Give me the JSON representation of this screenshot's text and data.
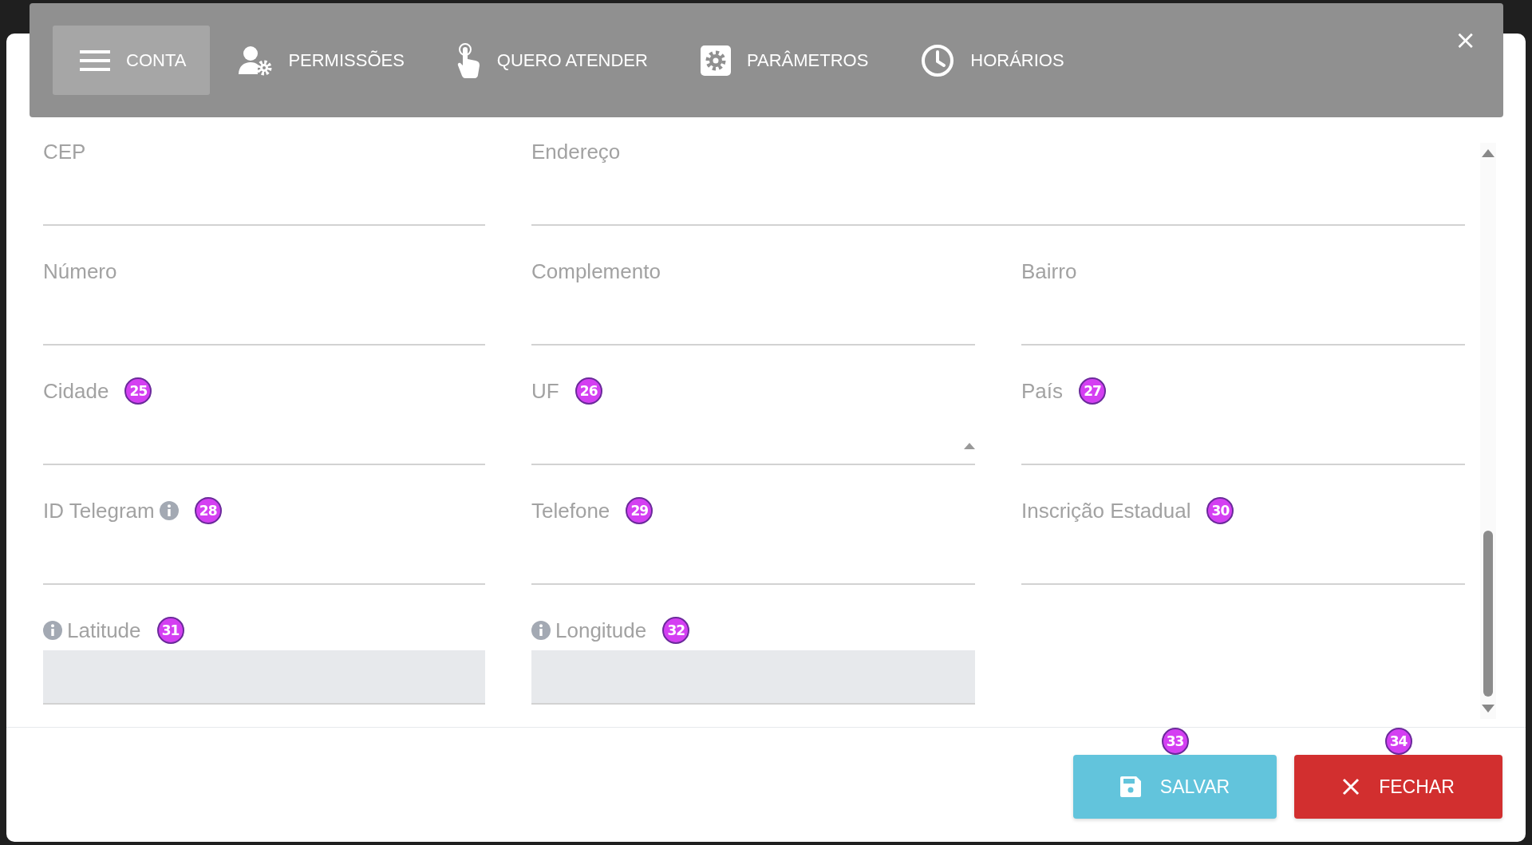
{
  "tabs": [
    {
      "label": "CONTA",
      "kind": "menu",
      "selected": true
    },
    {
      "label": "PERMISSÕES",
      "kind": "permissions",
      "selected": false
    },
    {
      "label": "QUERO ATENDER",
      "kind": "attend",
      "selected": false
    },
    {
      "label": "PARÂMETROS",
      "kind": "settings",
      "selected": false
    },
    {
      "label": "HORÁRIOS",
      "kind": "schedule",
      "selected": false
    }
  ],
  "close_label": "×",
  "fields": [
    {
      "label": "CEP",
      "kind": "text"
    },
    {
      "label": "Endereço",
      "kind": "text",
      "wide": true
    },
    {
      "label": "Número",
      "kind": "text"
    },
    {
      "label": "Complemento",
      "kind": "text"
    },
    {
      "label": "Bairro",
      "kind": "text"
    },
    {
      "label": "Cidade",
      "kind": "text",
      "badge": "25"
    },
    {
      "label": "UF",
      "kind": "select",
      "badge": "26"
    },
    {
      "label": "País",
      "kind": "text",
      "badge": "27"
    },
    {
      "label": "ID Telegram",
      "kind": "text",
      "info_after": true,
      "badge": "28"
    },
    {
      "label": "Telefone",
      "kind": "text",
      "badge": "29"
    },
    {
      "label": "Inscrição Estadual",
      "kind": "text",
      "badge": "30"
    },
    {
      "label": "Latitude",
      "kind": "readonly",
      "info_before": true,
      "badge": "31"
    },
    {
      "label": "Longitude",
      "kind": "readonly",
      "info_before": true,
      "badge": "32"
    }
  ],
  "buttons": [
    {
      "label": "SALVAR",
      "kind": "save",
      "badge": "33"
    },
    {
      "label": "FECHAR",
      "kind": "close",
      "badge": "34"
    }
  ]
}
